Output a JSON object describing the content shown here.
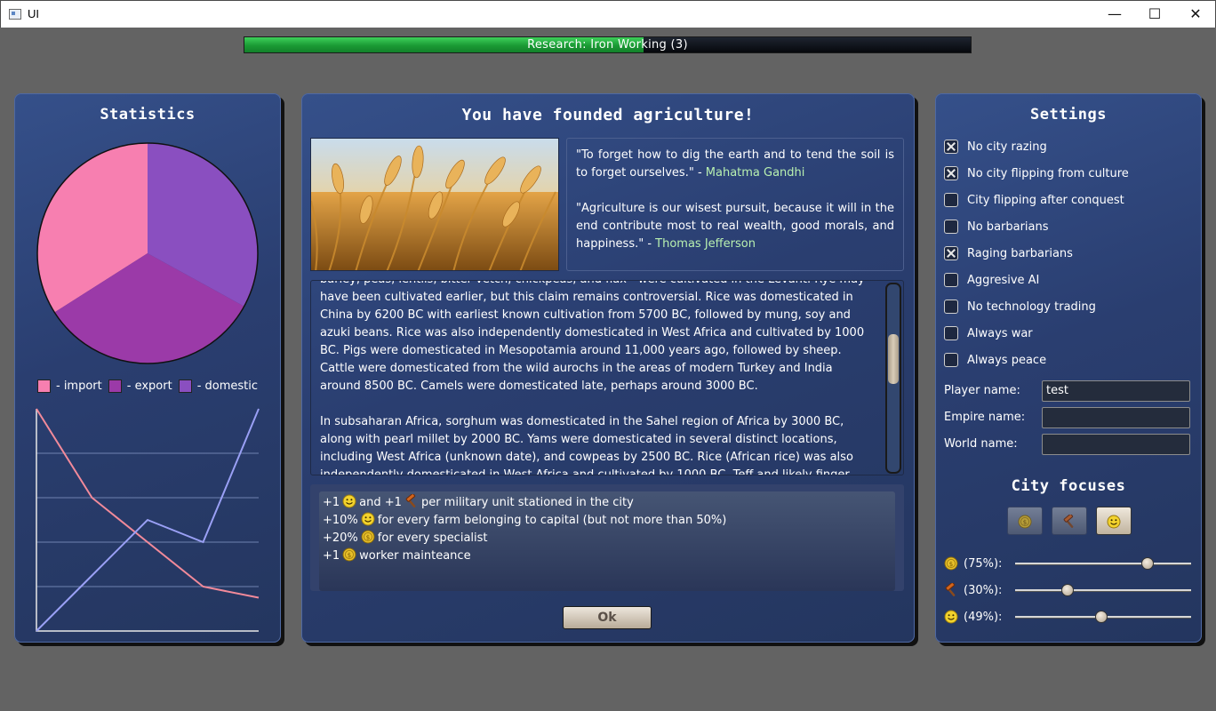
{
  "window": {
    "title": "UI",
    "minimize": "—",
    "maximize": "☐",
    "close": "✕"
  },
  "research": {
    "label": "Research: Iron Working (3)",
    "progress": 0.55
  },
  "statistics": {
    "title": "Statistics",
    "legend": [
      {
        "label": "- import",
        "color": "#f77fb0"
      },
      {
        "label": "- export",
        "color": "#9b3aa8"
      },
      {
        "label": "- domestic",
        "color": "#8a4fc0"
      }
    ]
  },
  "chart_data": [
    {
      "type": "pie",
      "labels": [
        "import",
        "export",
        "domestic"
      ],
      "values": [
        34,
        33,
        33
      ],
      "colors": [
        "#f77fb0",
        "#9b3aa8",
        "#8a4fc0"
      ]
    },
    {
      "type": "line",
      "x": [
        0,
        1,
        2,
        3,
        4
      ],
      "series": [
        {
          "values": [
            5.0,
            3.0,
            2.0,
            1.0,
            0.75
          ],
          "color": "#f28a9a"
        },
        {
          "values": [
            0.0,
            1.25,
            2.5,
            2.0,
            5.0
          ],
          "color": "#9aa0f5"
        }
      ],
      "ylim": [
        0,
        5
      ],
      "grid": true
    }
  ],
  "dialog": {
    "title": "You have founded agriculture!",
    "quotes": [
      {
        "text": "\"To forget how to dig the earth and to tend the soil is to forget ourselves.\" - ",
        "author": "Mahatma Gandhi"
      },
      {
        "text": "\"Agriculture is our wisest pursuit, because it will in the end contribute most to real wealth, good morals, and happiness.\" - ",
        "author": "Thomas Jefferson"
      }
    ],
    "article": [
      "barley, peas, lentils, bitter vetch, chickpeas, and flax - were cultivated in the Levant. Rye may have been cultivated earlier, but this claim remains controversial. Rice was domesticated in China by 6200 BC with earliest known cultivation from 5700 BC, followed by mung, soy and azuki beans. Rice was also independently domesticated in West Africa and cultivated by 1000 BC. Pigs were domesticated in Mesopotamia around 11,000 years ago, followed by sheep. Cattle were domesticated from the wild aurochs in the areas of modern Turkey and India around 8500 BC. Camels were domesticated late, perhaps around 3000 BC.",
      "In subsaharan Africa, sorghum was domesticated in the Sahel region of Africa by 3000 BC, along with pearl millet by 2000 BC. Yams were domesticated in several distinct locations, including West Africa (unknown date), and cowpeas by 2500 BC. Rice (African rice) was also independently domesticated in West Africa and cultivated by 1000 BC. Teff and likely finger"
    ],
    "bonuses": [
      {
        "prefix": "+1",
        "icons": [
          "smiley-icon"
        ],
        "mid": "and +1",
        "icons2": [
          "hammer-icon"
        ],
        "text": "per military unit stationed in the city"
      },
      {
        "prefix": "+10%",
        "icons": [
          "smiley-icon"
        ],
        "text": "for every farm belonging to capital (but not more than 50%)"
      },
      {
        "prefix": "+20%",
        "icons": [
          "coin-icon"
        ],
        "text": "for every specialist"
      },
      {
        "prefix": "+1",
        "icons": [
          "coin-icon"
        ],
        "text": "worker mainteance"
      }
    ],
    "ok_label": "Ok"
  },
  "settings": {
    "title": "Settings",
    "options": [
      {
        "label": "No city razing",
        "checked": true
      },
      {
        "label": "No city flipping from culture",
        "checked": true
      },
      {
        "label": "City flipping after conquest",
        "checked": false
      },
      {
        "label": "No barbarians",
        "checked": false
      },
      {
        "label": "Raging barbarians",
        "checked": true
      },
      {
        "label": "Aggresive AI",
        "checked": false
      },
      {
        "label": "No technology trading",
        "checked": false
      },
      {
        "label": "Always war",
        "checked": false
      },
      {
        "label": "Always peace",
        "checked": false
      }
    ],
    "player_name_label": "Player name:",
    "player_name": "test",
    "empire_name_label": "Empire name:",
    "empire_name": "",
    "world_name_label": "World name:",
    "world_name": "",
    "city_focuses_title": "City focuses",
    "focuses": [
      {
        "icon": "coin-icon",
        "active": false
      },
      {
        "icon": "hammer-icon",
        "active": false
      },
      {
        "icon": "smiley-icon",
        "active": true
      }
    ],
    "sliders": [
      {
        "icon": "coin-icon",
        "label": "(75%):",
        "value": 0.75
      },
      {
        "icon": "hammer-icon",
        "label": "(30%):",
        "value": 0.3
      },
      {
        "icon": "smiley-icon",
        "label": "(49%):",
        "value": 0.49
      }
    ]
  }
}
